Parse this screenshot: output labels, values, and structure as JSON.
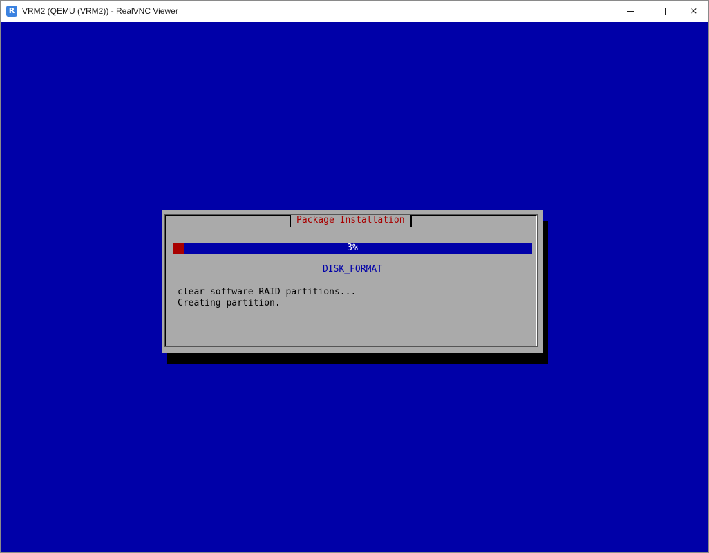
{
  "window": {
    "title": "VRM2 (QEMU (VRM2)) - RealVNC Viewer",
    "icon": "realvnc-logo-icon",
    "controls": {
      "minimize": "minimize-icon",
      "maximize": "maximize-icon",
      "close": "×"
    }
  },
  "installer": {
    "dialog_title": "Package Installation",
    "progress": {
      "percent": 3,
      "label": "3%"
    },
    "stage": "DISK_FORMAT",
    "log": [
      "clear software RAID partitions...",
      "Creating partition."
    ]
  },
  "colors": {
    "screen_bg": "#0000a8",
    "dialog_bg": "#aaaaaa",
    "title_text": "#a80000",
    "progress_fill": "#a80000",
    "stage_text": "#0000a8"
  }
}
